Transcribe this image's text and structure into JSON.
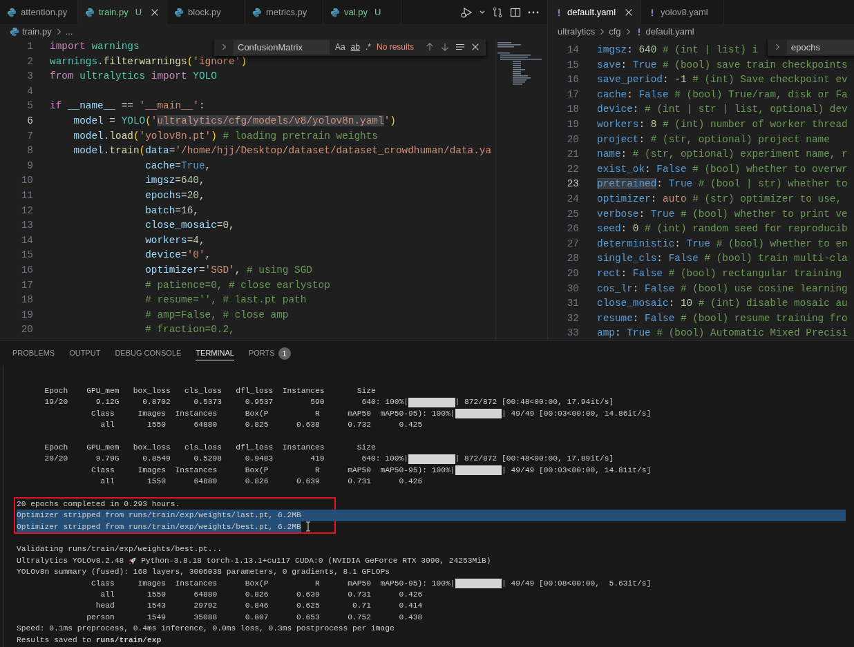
{
  "editor_left": {
    "tabs": [
      {
        "label": "attention.py",
        "selected": false,
        "untracked": false
      },
      {
        "label": "train.py",
        "selected": true,
        "untracked": true,
        "badge": "U"
      },
      {
        "label": "block.py",
        "selected": false,
        "untracked": false
      },
      {
        "label": "metrics.py",
        "selected": false,
        "untracked": false
      },
      {
        "label": "val.py",
        "selected": false,
        "untracked": true,
        "badge": "U"
      }
    ],
    "breadcrumb": [
      "train.py",
      "..."
    ],
    "find_widget": {
      "query": "ConfusionMatrix",
      "options": [
        "Aa",
        "ab",
        ".*"
      ],
      "result": "No results"
    },
    "lines": [
      {
        "number": "1",
        "current": false,
        "tokens": [
          {
            "kind": "kw",
            "text": "import"
          },
          {
            "kind": "mod",
            "text": " warnings"
          }
        ]
      },
      {
        "number": "2",
        "current": false,
        "tokens": [
          {
            "kind": "mod",
            "text": "warnings"
          },
          {
            "kind": "p",
            "text": "."
          },
          {
            "kind": "fn",
            "text": "filterwarnings"
          },
          {
            "kind": "br",
            "text": "("
          },
          {
            "kind": "str",
            "text": "'ignore'"
          },
          {
            "kind": "br",
            "text": ")"
          }
        ]
      },
      {
        "number": "3",
        "current": false,
        "tokens": [
          {
            "kind": "kw",
            "text": "from"
          },
          {
            "kind": "mod",
            "text": " ultralytics"
          },
          {
            "kind": "kw",
            "text": " import"
          },
          {
            "kind": "mod",
            "text": " YOLO"
          }
        ]
      },
      {
        "number": "4",
        "current": false
      },
      {
        "number": "5",
        "current": false,
        "tokens": [
          {
            "kind": "kw",
            "text": "if"
          },
          {
            "kind": "var",
            "text": " __name__"
          },
          {
            "kind": "p",
            "text": " =="
          },
          {
            "kind": "str",
            "text": " '__main__'"
          },
          {
            "kind": "p",
            "text": ":"
          }
        ]
      },
      {
        "number": "6",
        "current": true,
        "tokens": [
          {
            "kind": "var",
            "text": "    model"
          },
          {
            "kind": "p",
            "text": " ="
          },
          {
            "kind": "mod",
            "text": " YOLO"
          },
          {
            "kind": "br",
            "text": "("
          },
          {
            "kind": "str",
            "text": "'"
          },
          {
            "kind": "match",
            "text": "ultralytics/cfg/models/v8/yolov8n.yaml"
          },
          {
            "kind": "str",
            "text": "'"
          },
          {
            "kind": "br",
            "text": ")"
          }
        ]
      },
      {
        "number": "7",
        "current": false,
        "tokens": [
          {
            "kind": "var",
            "text": "    model"
          },
          {
            "kind": "p",
            "text": "."
          },
          {
            "kind": "fn",
            "text": "load"
          },
          {
            "kind": "br",
            "text": "("
          },
          {
            "kind": "str",
            "text": "'yolov8n.pt'"
          },
          {
            "kind": "br",
            "text": ")"
          },
          {
            "kind": "cmt",
            "text": " # loading pretrain weights"
          }
        ]
      },
      {
        "number": "8",
        "current": false,
        "tokens": [
          {
            "kind": "var",
            "text": "    model"
          },
          {
            "kind": "p",
            "text": "."
          },
          {
            "kind": "fn",
            "text": "train"
          },
          {
            "kind": "br",
            "text": "("
          },
          {
            "kind": "var",
            "text": "data"
          },
          {
            "kind": "p",
            "text": "="
          },
          {
            "kind": "str",
            "text": "'/home/hjj/Desktop/dataset/dataset_crowdhuman/data.ya"
          }
        ]
      },
      {
        "number": "9",
        "current": false,
        "tokens": [
          {
            "kind": "var",
            "text": "                cache"
          },
          {
            "kind": "p",
            "text": "="
          },
          {
            "kind": "bool",
            "text": "True"
          },
          {
            "kind": "p",
            "text": ","
          }
        ]
      },
      {
        "number": "10",
        "current": false,
        "tokens": [
          {
            "kind": "var",
            "text": "                imgsz"
          },
          {
            "kind": "p",
            "text": "="
          },
          {
            "kind": "num",
            "text": "640"
          },
          {
            "kind": "p",
            "text": ","
          }
        ]
      },
      {
        "number": "11",
        "current": false,
        "tokens": [
          {
            "kind": "var",
            "text": "                epochs"
          },
          {
            "kind": "p",
            "text": "="
          },
          {
            "kind": "num",
            "text": "20"
          },
          {
            "kind": "p",
            "text": ","
          }
        ]
      },
      {
        "number": "12",
        "current": false,
        "tokens": [
          {
            "kind": "var",
            "text": "                batch"
          },
          {
            "kind": "p",
            "text": "="
          },
          {
            "kind": "num",
            "text": "16"
          },
          {
            "kind": "p",
            "text": ","
          }
        ]
      },
      {
        "number": "13",
        "current": false,
        "tokens": [
          {
            "kind": "var",
            "text": "                close_mosaic"
          },
          {
            "kind": "p",
            "text": "="
          },
          {
            "kind": "num",
            "text": "0"
          },
          {
            "kind": "p",
            "text": ","
          }
        ]
      },
      {
        "number": "14",
        "current": false,
        "tokens": [
          {
            "kind": "var",
            "text": "                workers"
          },
          {
            "kind": "p",
            "text": "="
          },
          {
            "kind": "num",
            "text": "4"
          },
          {
            "kind": "p",
            "text": ","
          }
        ]
      },
      {
        "number": "15",
        "current": false,
        "tokens": [
          {
            "kind": "var",
            "text": "                device"
          },
          {
            "kind": "p",
            "text": "="
          },
          {
            "kind": "str",
            "text": "'0'"
          },
          {
            "kind": "p",
            "text": ","
          }
        ]
      },
      {
        "number": "16",
        "current": false,
        "tokens": [
          {
            "kind": "var",
            "text": "                optimizer"
          },
          {
            "kind": "p",
            "text": "="
          },
          {
            "kind": "str",
            "text": "'SGD'"
          },
          {
            "kind": "p",
            "text": ","
          },
          {
            "kind": "cmt",
            "text": " # using SGD"
          }
        ]
      },
      {
        "number": "17",
        "current": false,
        "tokens": [
          {
            "kind": "cmt",
            "text": "                # patience=0, # close earlystop"
          }
        ]
      },
      {
        "number": "18",
        "current": false,
        "tokens": [
          {
            "kind": "cmt",
            "text": "                # resume='', # last.pt path"
          }
        ]
      },
      {
        "number": "19",
        "current": false,
        "tokens": [
          {
            "kind": "cmt",
            "text": "                # amp=False, # close amp"
          }
        ]
      },
      {
        "number": "20",
        "current": false,
        "tokens": [
          {
            "kind": "cmt",
            "text": "                # fraction=0.2,"
          }
        ]
      }
    ]
  },
  "editor_right": {
    "tabs": [
      {
        "label": "default.yaml",
        "selected": true
      },
      {
        "label": "yolov8.yaml",
        "selected": false
      }
    ],
    "breadcrumb": [
      "ultralytics",
      "cfg",
      "default.yaml"
    ],
    "find_widget": {
      "query": "epochs"
    },
    "lines": [
      {
        "number": "14",
        "current": false,
        "tokens": [
          {
            "kind": "key",
            "text": "imgsz"
          },
          {
            "kind": "p",
            "text": ":"
          },
          {
            "kind": "num",
            "text": " 640"
          },
          {
            "kind": "cmt",
            "text": " # (int | list) i"
          }
        ]
      },
      {
        "number": "15",
        "current": false,
        "tokens": [
          {
            "kind": "key",
            "text": "save"
          },
          {
            "kind": "p",
            "text": ":"
          },
          {
            "kind": "bool",
            "text": " True"
          },
          {
            "kind": "cmt",
            "text": " # (bool) save train checkpoints"
          }
        ]
      },
      {
        "number": "16",
        "current": false,
        "tokens": [
          {
            "kind": "key",
            "text": "save_period"
          },
          {
            "kind": "p",
            "text": ":"
          },
          {
            "kind": "num",
            "text": " -1"
          },
          {
            "kind": "cmt",
            "text": " # (int) Save checkpoint ev"
          }
        ]
      },
      {
        "number": "17",
        "current": false,
        "tokens": [
          {
            "kind": "key",
            "text": "cache"
          },
          {
            "kind": "p",
            "text": ":"
          },
          {
            "kind": "bool",
            "text": " False"
          },
          {
            "kind": "cmt",
            "text": " # (bool) True/ram, disk or Fa"
          }
        ]
      },
      {
        "number": "18",
        "current": false,
        "tokens": [
          {
            "kind": "key",
            "text": "device"
          },
          {
            "kind": "p",
            "text": ":"
          },
          {
            "kind": "cmt",
            "text": " # (int | str | list, optional) dev"
          }
        ]
      },
      {
        "number": "19",
        "current": false,
        "tokens": [
          {
            "kind": "key",
            "text": "workers"
          },
          {
            "kind": "p",
            "text": ":"
          },
          {
            "kind": "num",
            "text": " 8"
          },
          {
            "kind": "cmt",
            "text": " # (int) number of worker thread"
          }
        ]
      },
      {
        "number": "20",
        "current": false,
        "tokens": [
          {
            "kind": "key",
            "text": "project"
          },
          {
            "kind": "p",
            "text": ":"
          },
          {
            "kind": "cmt",
            "text": " # (str, optional) project name"
          }
        ]
      },
      {
        "number": "21",
        "current": false,
        "tokens": [
          {
            "kind": "key",
            "text": "name"
          },
          {
            "kind": "p",
            "text": ":"
          },
          {
            "kind": "cmt",
            "text": " # (str, optional) experiment name, r"
          }
        ]
      },
      {
        "number": "22",
        "current": false,
        "tokens": [
          {
            "kind": "key",
            "text": "exist_ok"
          },
          {
            "kind": "p",
            "text": ":"
          },
          {
            "kind": "bool",
            "text": " False"
          },
          {
            "kind": "cmt",
            "text": " # (bool) whether to overwr"
          }
        ]
      },
      {
        "number": "23",
        "current": true,
        "tokens": [
          {
            "kind": "keymatch",
            "text": "pretrained"
          },
          {
            "kind": "p",
            "text": ":"
          },
          {
            "kind": "bool",
            "text": " True"
          },
          {
            "kind": "cmt",
            "text": " # (bool | str) whether to"
          }
        ]
      },
      {
        "number": "24",
        "current": false,
        "tokens": [
          {
            "kind": "key",
            "text": "optimizer"
          },
          {
            "kind": "p",
            "text": ":"
          },
          {
            "kind": "str",
            "text": " auto"
          },
          {
            "kind": "cmt",
            "text": " # (str) optimizer to use,"
          }
        ]
      },
      {
        "number": "25",
        "current": false,
        "tokens": [
          {
            "kind": "key",
            "text": "verbose"
          },
          {
            "kind": "p",
            "text": ":"
          },
          {
            "kind": "bool",
            "text": " True"
          },
          {
            "kind": "cmt",
            "text": " # (bool) whether to print ve"
          }
        ]
      },
      {
        "number": "26",
        "current": false,
        "tokens": [
          {
            "kind": "key",
            "text": "seed"
          },
          {
            "kind": "p",
            "text": ":"
          },
          {
            "kind": "num",
            "text": " 0"
          },
          {
            "kind": "cmt",
            "text": " # (int) random seed for reproducib"
          }
        ]
      },
      {
        "number": "27",
        "current": false,
        "tokens": [
          {
            "kind": "key",
            "text": "deterministic"
          },
          {
            "kind": "p",
            "text": ":"
          },
          {
            "kind": "bool",
            "text": " True"
          },
          {
            "kind": "cmt",
            "text": " # (bool) whether to en"
          }
        ]
      },
      {
        "number": "28",
        "current": false,
        "tokens": [
          {
            "kind": "key",
            "text": "single_cls"
          },
          {
            "kind": "p",
            "text": ":"
          },
          {
            "kind": "bool",
            "text": " False"
          },
          {
            "kind": "cmt",
            "text": " # (bool) train multi-cla"
          }
        ]
      },
      {
        "number": "29",
        "current": false,
        "tokens": [
          {
            "kind": "key",
            "text": "rect"
          },
          {
            "kind": "p",
            "text": ":"
          },
          {
            "kind": "bool",
            "text": " False"
          },
          {
            "kind": "cmt",
            "text": " # (bool) rectangular training"
          }
        ]
      },
      {
        "number": "30",
        "current": false,
        "tokens": [
          {
            "kind": "key",
            "text": "cos_lr"
          },
          {
            "kind": "p",
            "text": ":"
          },
          {
            "kind": "bool",
            "text": " False"
          },
          {
            "kind": "cmt",
            "text": " # (bool) use cosine learning"
          }
        ]
      },
      {
        "number": "31",
        "current": false,
        "tokens": [
          {
            "kind": "key",
            "text": "close_mosaic"
          },
          {
            "kind": "p",
            "text": ":"
          },
          {
            "kind": "num",
            "text": " 10"
          },
          {
            "kind": "cmt",
            "text": " # (int) disable mosaic au"
          }
        ]
      },
      {
        "number": "32",
        "current": false,
        "tokens": [
          {
            "kind": "key",
            "text": "resume"
          },
          {
            "kind": "p",
            "text": ":"
          },
          {
            "kind": "bool",
            "text": " False"
          },
          {
            "kind": "cmt",
            "text": " # (bool) resume training fro"
          }
        ]
      },
      {
        "number": "33",
        "current": false,
        "tokens": [
          {
            "kind": "key",
            "text": "amp"
          },
          {
            "kind": "p",
            "text": ":"
          },
          {
            "kind": "bool",
            "text": " True"
          },
          {
            "kind": "cmt",
            "text": " # (bool) Automatic Mixed Precisi"
          }
        ]
      }
    ]
  },
  "panel": {
    "tabs": [
      {
        "label": "PROBLEMS",
        "selected": false
      },
      {
        "label": "OUTPUT",
        "selected": false
      },
      {
        "label": "DEBUG CONSOLE",
        "selected": false
      },
      {
        "label": "TERMINAL",
        "selected": true
      },
      {
        "label": "PORTS",
        "selected": false,
        "badge": "1"
      }
    ],
    "terminal": {
      "blocks": [
        {
          "lines": [
            {
              "selected": false,
              "parts": [
                {
                  "kind": "text",
                  "text": "      Epoch    GPU_mem   box_loss   cls_loss   dfl_loss  Instances       Size"
                }
              ]
            },
            {
              "selected": false,
              "parts": [
                {
                  "kind": "text",
                  "text": "      19/20      9.12G     0.8702     0.5373     0.9537        590        640: 100%|"
                },
                {
                  "kind": "bar",
                  "level": 1
                },
                {
                  "kind": "text",
                  "text": "| 872/872 [00:48<00:00, 17.94it/s]"
                }
              ]
            },
            {
              "selected": false,
              "parts": [
                {
                  "kind": "text",
                  "text": "                Class     Images  Instances      Box(P          R      mAP50  mAP50-95): 100%|"
                },
                {
                  "kind": "bar",
                  "level": 1
                },
                {
                  "kind": "text",
                  "text": "| 49/49 [00:03<00:00, 14.86it/s]"
                }
              ]
            },
            {
              "selected": false,
              "parts": [
                {
                  "kind": "text",
                  "text": "                  all       1550      64880      0.825      0.638      0.732      0.425"
                }
              ]
            }
          ]
        },
        {
          "lines": [
            {
              "selected": false,
              "parts": [
                {
                  "kind": "text",
                  "text": "      Epoch    GPU_mem   box_loss   cls_loss   dfl_loss  Instances       Size"
                }
              ]
            },
            {
              "selected": false,
              "parts": [
                {
                  "kind": "text",
                  "text": "      20/20      9.79G     0.8549     0.5298     0.9483        419        640: 100%|"
                },
                {
                  "kind": "bar",
                  "level": 1
                },
                {
                  "kind": "text",
                  "text": "| 872/872 [00:48<00:00, 17.89it/s]"
                }
              ]
            },
            {
              "selected": false,
              "parts": [
                {
                  "kind": "text",
                  "text": "                Class     Images  Instances      Box(P          R      mAP50  mAP50-95): 100%|"
                },
                {
                  "kind": "bar",
                  "level": 1
                },
                {
                  "kind": "text",
                  "text": "| 49/49 [00:03<00:00, 14.81it/s]"
                }
              ]
            },
            {
              "selected": false,
              "parts": [
                {
                  "kind": "text",
                  "text": "                  all       1550      64880      0.826      0.639      0.731      0.426"
                }
              ]
            }
          ]
        },
        {
          "red_box": true,
          "lines": [
            {
              "selected": false,
              "parts": [
                {
                  "kind": "text",
                  "text": "20 epochs completed in 0.293 hours."
                }
              ]
            },
            {
              "selected": true,
              "line_end_selected": true,
              "parts": [
                {
                  "kind": "text",
                  "text": "Optimizer stripped from runs/train/exp/weights/last.pt, 6.2MB"
                }
              ]
            },
            {
              "selected": true,
              "line_end_selected": false,
              "parts": [
                {
                  "kind": "text",
                  "text": "Optimizer stripped from runs/train/exp/weights/best.pt, 6.2MB"
                },
                {
                  "kind": "cursor"
                }
              ]
            }
          ]
        },
        {
          "lines": [
            {
              "selected": false,
              "parts": [
                {
                  "kind": "text",
                  "text": "Validating runs/train/exp/weights/best.pt..."
                }
              ]
            },
            {
              "selected": false,
              "parts": [
                {
                  "kind": "text",
                  "text": "Ultralytics YOLOv8.2.48"
                },
                {
                  "kind": "rocket"
                },
                {
                  "kind": "text",
                  "text": "Python-3.8.18 torch-1.13.1+cu117 CUDA:0 (NVIDIA GeForce RTX 3090, 24253MiB)"
                }
              ]
            },
            {
              "selected": false,
              "parts": [
                {
                  "kind": "text",
                  "text": "YOLOv8n summary (fused): 168 layers, 3006038 parameters, 0 gradients, 8.1 GFLOPs"
                }
              ]
            },
            {
              "selected": false,
              "parts": [
                {
                  "kind": "text",
                  "text": "                Class     Images  Instances      Box(P          R      mAP50  mAP50-95): 100%|"
                },
                {
                  "kind": "bar",
                  "level": 1
                },
                {
                  "kind": "text",
                  "text": "| 49/49 [00:08<00:00,  5.63it/s]"
                }
              ]
            },
            {
              "selected": false,
              "parts": [
                {
                  "kind": "text",
                  "text": "                  all       1550      64880      0.826      0.639      0.731      0.426"
                }
              ]
            },
            {
              "selected": false,
              "parts": [
                {
                  "kind": "text",
                  "text": "                 head       1543      29792      0.846      0.625       0.71      0.414"
                }
              ]
            },
            {
              "selected": false,
              "parts": [
                {
                  "kind": "text",
                  "text": "               person       1549      35088      0.807      0.653      0.752      0.438"
                }
              ]
            },
            {
              "selected": false,
              "parts": [
                {
                  "kind": "text",
                  "text": "Speed: 0.1ms preprocess, 0.4ms inference, 0.0ms loss, 0.3ms postprocess per image"
                }
              ]
            },
            {
              "selected": false,
              "parts": [
                {
                  "kind": "text",
                  "text": "Results saved to **runs/train/exp**"
                }
              ]
            }
          ]
        }
      ]
    }
  }
}
